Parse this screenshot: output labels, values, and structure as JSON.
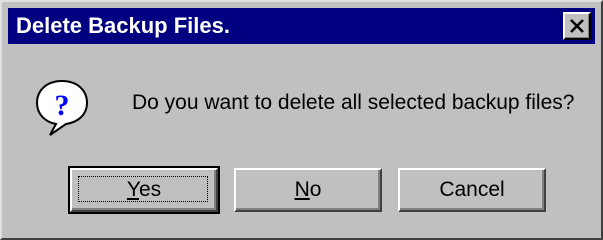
{
  "dialog": {
    "title": "Delete Backup Files.",
    "close_glyph": "✕",
    "icon": "question-icon",
    "message": "Do you want to delete all selected backup files?"
  },
  "buttons": {
    "yes": {
      "mnemonic": "Y",
      "rest": "es"
    },
    "no": {
      "mnemonic": "N",
      "rest": "o"
    },
    "cancel": {
      "label": "Cancel"
    }
  },
  "colors": {
    "titlebar": "#000080",
    "face": "#c0c0c0"
  }
}
